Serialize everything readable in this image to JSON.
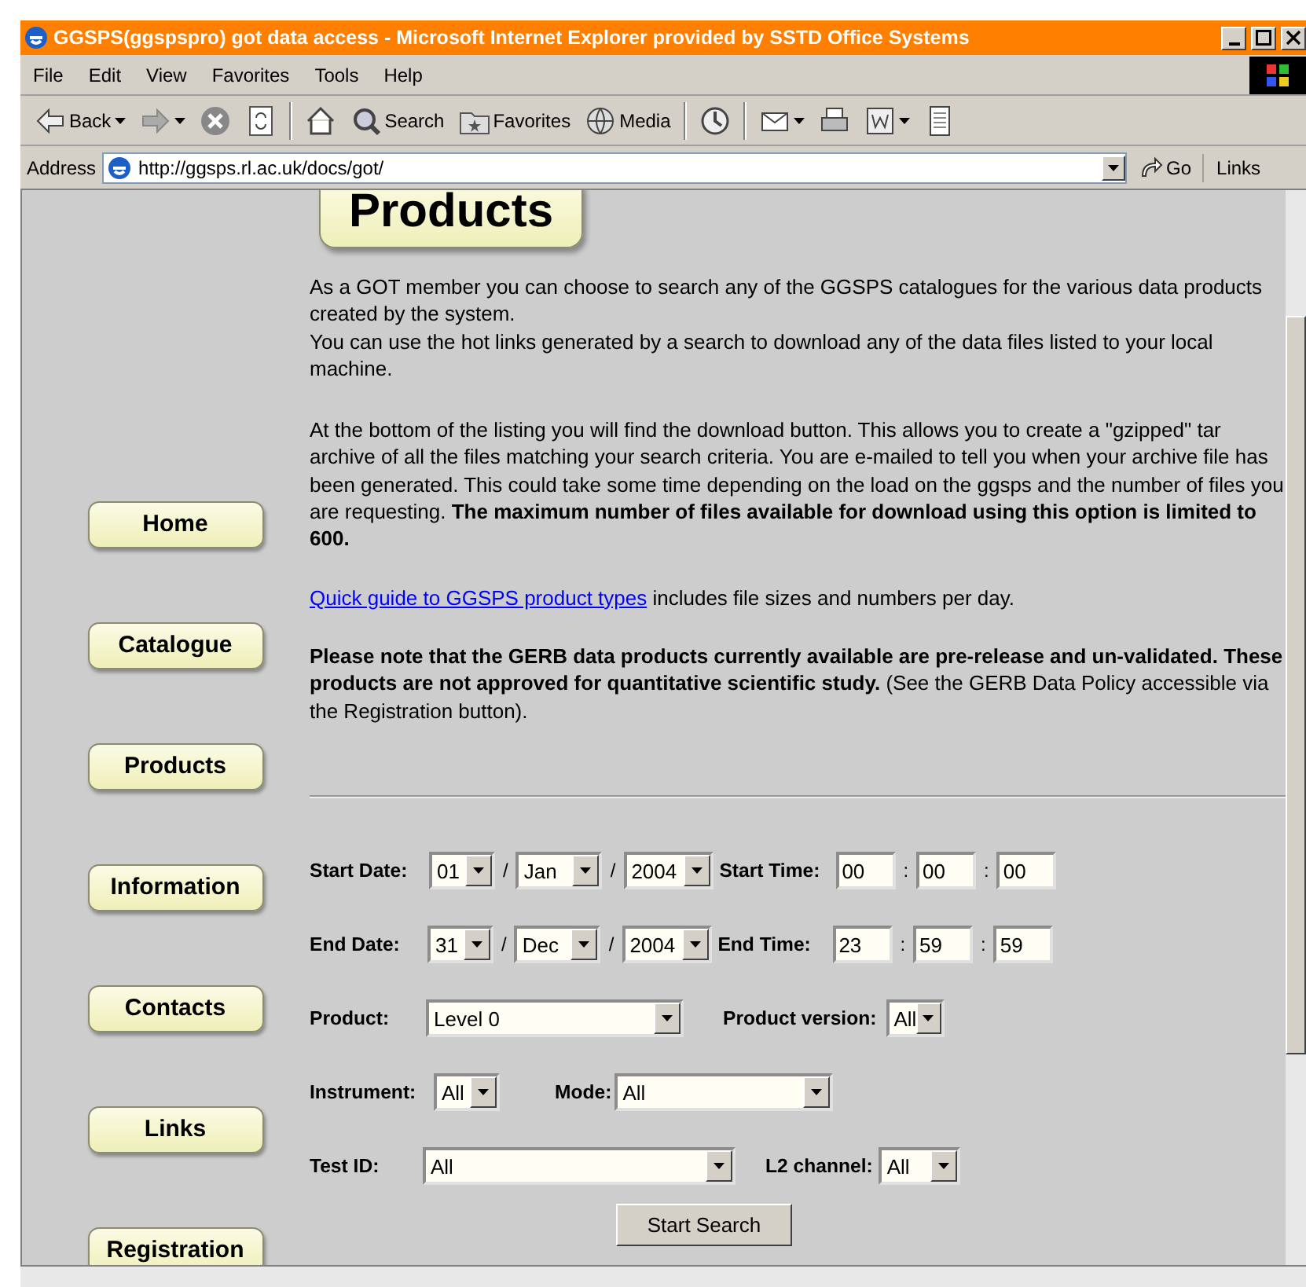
{
  "window": {
    "title": "GGSPS(ggspspro) got data access - Microsoft Internet Explorer provided by SSTD Office Systems"
  },
  "menu_bar": [
    "File",
    "Edit",
    "View",
    "Favorites",
    "Tools",
    "Help"
  ],
  "toolbar": [
    {
      "kind": "back",
      "label": "Back",
      "dropdown": true
    },
    {
      "kind": "forward",
      "dropdown": true
    },
    {
      "kind": "stop"
    },
    {
      "kind": "refresh"
    },
    {
      "kind": "home"
    },
    {
      "kind": "search",
      "label": "Search"
    },
    {
      "kind": "favorites",
      "label": "Favorites"
    },
    {
      "kind": "media",
      "label": "Media"
    },
    {
      "kind": "history"
    },
    {
      "kind": "mail",
      "dropdown": true
    },
    {
      "kind": "print"
    },
    {
      "kind": "edit",
      "dropdown": true
    },
    {
      "kind": "discuss"
    }
  ],
  "address_bar": {
    "label": "Address",
    "url": "http://ggsps.rl.ac.uk/docs/got/",
    "go": "Go",
    "links": "Links"
  },
  "nav": [
    "Home",
    "Catalogue",
    "Products",
    "Information",
    "Contacts",
    "Links",
    "Registration"
  ],
  "heading": "Products",
  "intro": [
    "As a GOT member you can choose to search any of the GGSPS catalogues for the various data products created by the system.",
    "You can use the hot links generated by a search to download any of the data files listed to your local machine."
  ],
  "download_note": "At the bottom of the listing you will find the download button. This allows you to create a \"gzipped\" tar archive of all the files matching your search criteria. You are e-mailed to tell you when your archive file has been generated. This could take some time depending on the load on the ggsps and the number of files you are requesting. **The maximum number of files available for download using this option is limited to 600.**",
  "guide": {
    "link": "Quick guide to GGSPS product types",
    "text": " includes file sizes and numbers per day."
  },
  "notice": "**Please note that the GERB data products currently available are pre-release and un-validated. These products are not approved for quantitative scientific study.** (See the GERB Data Policy accessible via the Registration button).",
  "form": {
    "rows": [
      [
        {
          "kind": "label",
          "text": "Start Date:"
        },
        {
          "kind": "select",
          "value": "01"
        },
        {
          "kind": "sep",
          "text": "/"
        },
        {
          "kind": "select",
          "value": "Jan"
        },
        {
          "kind": "sep",
          "text": "/"
        },
        {
          "kind": "select",
          "value": "2004"
        },
        {
          "kind": "label",
          "text": "Start Time:"
        },
        {
          "kind": "input",
          "value": "00"
        },
        {
          "kind": "sep",
          "text": ":"
        },
        {
          "kind": "input",
          "value": "00"
        },
        {
          "kind": "sep",
          "text": ":"
        },
        {
          "kind": "input",
          "value": "00"
        }
      ],
      [
        {
          "kind": "label",
          "text": "End Date:"
        },
        {
          "kind": "select",
          "value": "31"
        },
        {
          "kind": "sep",
          "text": "/"
        },
        {
          "kind": "select",
          "value": "Dec"
        },
        {
          "kind": "sep",
          "text": "/"
        },
        {
          "kind": "select",
          "value": "2004"
        },
        {
          "kind": "label",
          "text": "End Time:"
        },
        {
          "kind": "input",
          "value": "23"
        },
        {
          "kind": "sep",
          "text": ":"
        },
        {
          "kind": "input",
          "value": "59"
        },
        {
          "kind": "sep",
          "text": ":"
        },
        {
          "kind": "input",
          "value": "59"
        }
      ],
      [
        {
          "kind": "label",
          "text": "Product:"
        },
        {
          "kind": "select",
          "value": "Level 0"
        },
        {
          "kind": "label",
          "text": "Product version:"
        },
        {
          "kind": "select",
          "value": "All"
        }
      ],
      [
        {
          "kind": "label",
          "text": "Instrument:"
        },
        {
          "kind": "select",
          "value": "All"
        },
        {
          "kind": "label",
          "text": "Mode:"
        },
        {
          "kind": "select",
          "value": "All"
        }
      ],
      [
        {
          "kind": "label",
          "text": "Test ID:"
        },
        {
          "kind": "select",
          "value": "All"
        },
        {
          "kind": "label",
          "text": "L2 channel:"
        },
        {
          "kind": "select",
          "value": "All"
        }
      ]
    ],
    "submit": "Start Search"
  }
}
